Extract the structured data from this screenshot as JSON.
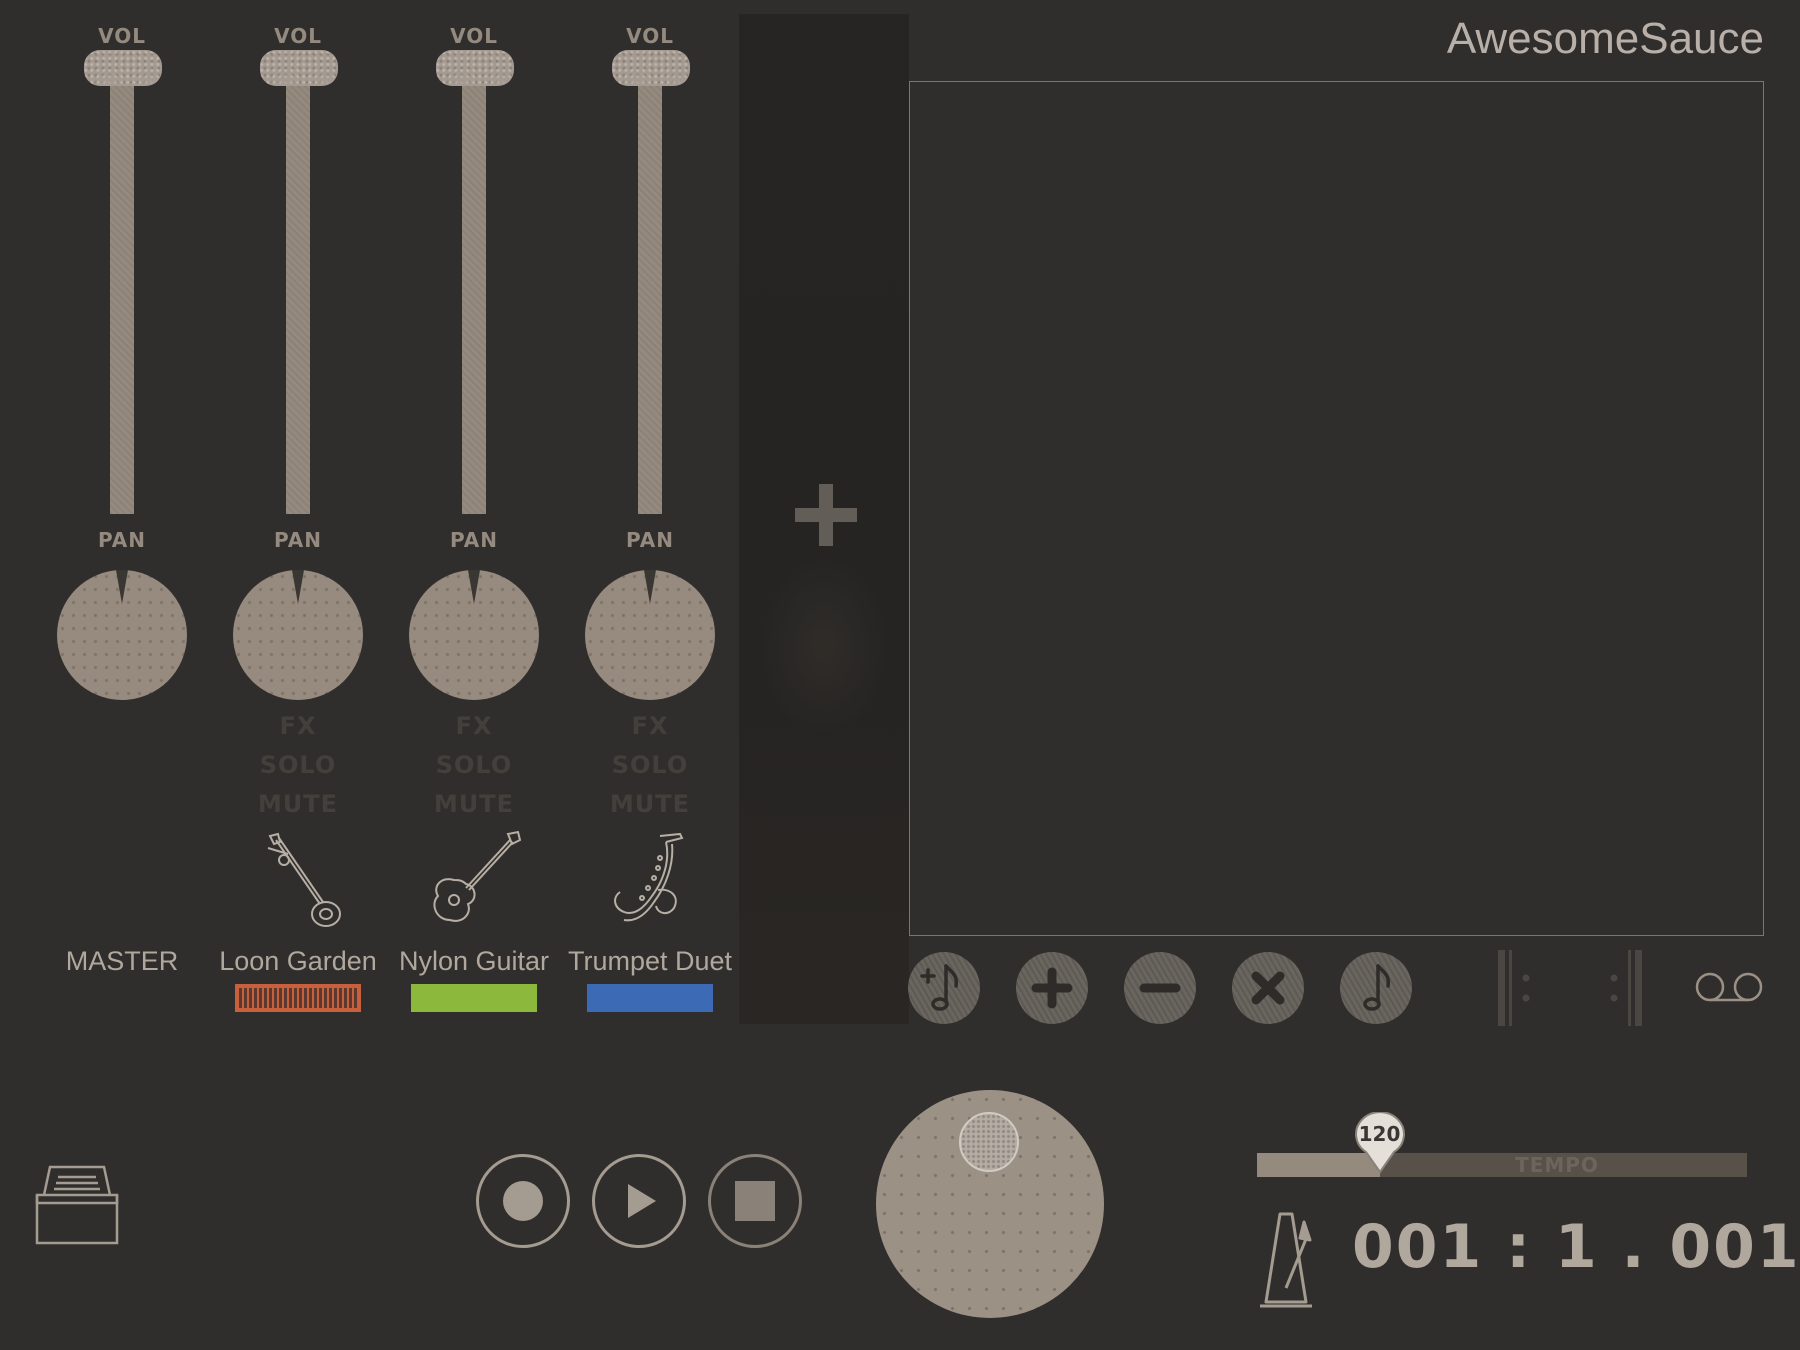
{
  "app": {
    "title": "AwesomeSauce"
  },
  "channels": [
    {
      "vol_label": "VOL",
      "pan_label": "PAN",
      "fx": "",
      "solo": "",
      "mute": "",
      "name": "MASTER",
      "instrument_icon": "",
      "color": ""
    },
    {
      "vol_label": "VOL",
      "pan_label": "PAN",
      "fx": "FX",
      "solo": "SOLO",
      "mute": "MUTE",
      "name": "Loon Garden",
      "instrument_icon": "sitar-icon",
      "color": "#c8603c"
    },
    {
      "vol_label": "VOL",
      "pan_label": "PAN",
      "fx": "FX",
      "solo": "SOLO",
      "mute": "MUTE",
      "name": "Nylon Guitar",
      "instrument_icon": "guitar-icon",
      "color": "#8cb83c"
    },
    {
      "vol_label": "VOL",
      "pan_label": "PAN",
      "fx": "FX",
      "solo": "SOLO",
      "mute": "MUTE",
      "name": "Trumpet Duet",
      "instrument_icon": "saxophone-icon",
      "color": "#3c6ab4"
    }
  ],
  "add_track": {
    "icon": "plus-icon"
  },
  "toolbar": {
    "tools": [
      "add-note-icon",
      "plus-icon",
      "minus-icon",
      "close-icon",
      "note-icon"
    ],
    "right_tools": [
      "repeat-start-icon",
      "repeat-end-icon",
      "loop-icon"
    ]
  },
  "transport": {
    "buttons": [
      "record-icon",
      "play-icon",
      "stop-icon"
    ],
    "archive_icon": "archive-box-icon",
    "metronome_icon": "metronome-icon"
  },
  "tempo": {
    "label": "TEMPO",
    "value": "120",
    "level": 0.25
  },
  "position": {
    "display": "001 : 1 . 001"
  },
  "colors": {
    "background": "#302e2c",
    "accent": "#958a7e"
  }
}
